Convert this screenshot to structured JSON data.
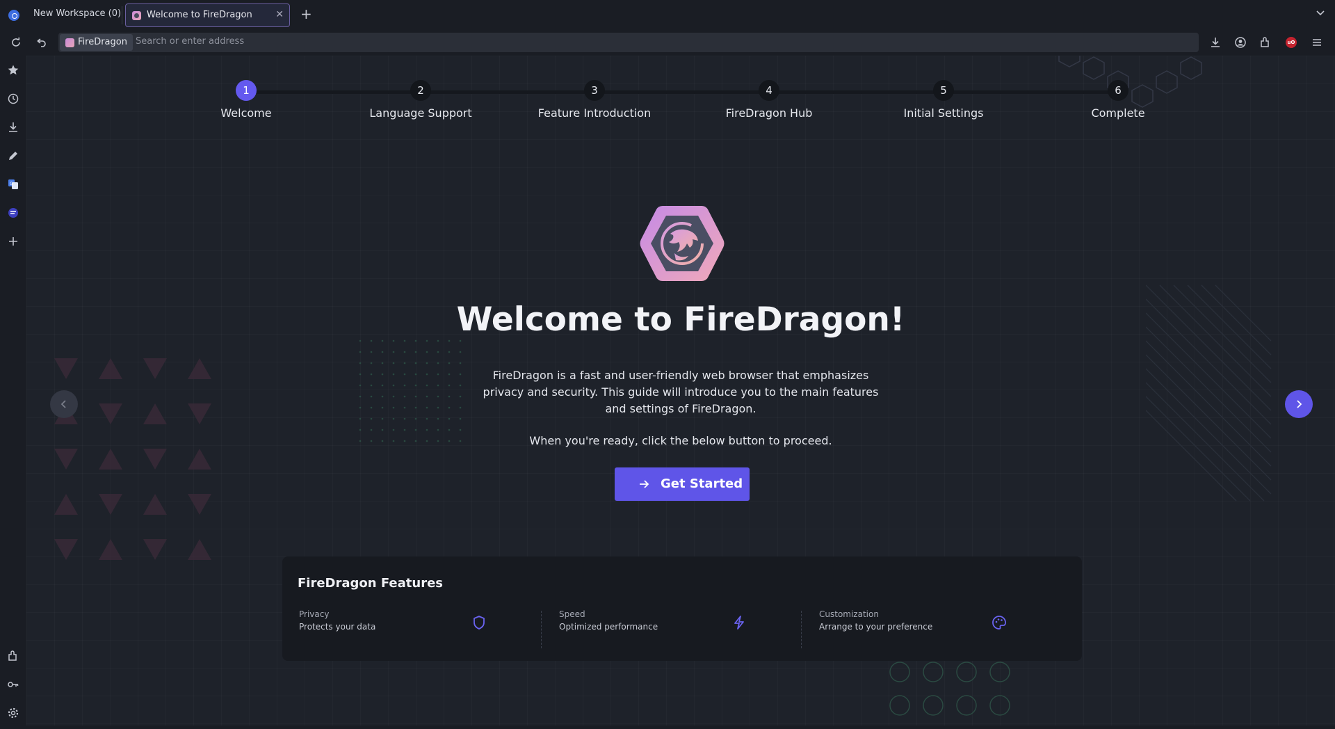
{
  "browser": {
    "workspace_label": "New Workspace (0)",
    "tabs": [
      {
        "title": "Welcome to FireDragon",
        "active": true
      }
    ],
    "identity_label": "FireDragon",
    "url_placeholder": "Search or enter address",
    "ublock_badge": "uO",
    "icons": {
      "toolbar": [
        "reload-icon",
        "undo-icon",
        "downloads-icon",
        "account-icon",
        "extensions-icon",
        "ublock-icon",
        "menu-icon"
      ],
      "sidebar": [
        "bookmarks-star-icon",
        "history-icon",
        "downloads-icon",
        "notes-pen-icon",
        "translate-icon",
        "firedragon-icon",
        "add-panel-icon",
        "extensions-icon",
        "passwords-key-icon",
        "settings-gear-icon"
      ]
    }
  },
  "stepper": {
    "active_step": 1,
    "steps": [
      {
        "num": "1",
        "label": "Welcome"
      },
      {
        "num": "2",
        "label": "Language Support"
      },
      {
        "num": "3",
        "label": "Feature Introduction"
      },
      {
        "num": "4",
        "label": "FireDragon Hub"
      },
      {
        "num": "5",
        "label": "Initial Settings"
      },
      {
        "num": "6",
        "label": "Complete"
      }
    ]
  },
  "hero": {
    "title": "Welcome to FireDragon!",
    "description": "FireDragon is a fast and user-friendly web browser that emphasizes privacy and security. This guide will introduce you to the main features and settings of FireDragon.",
    "ready_text": "When you're ready, click the below button to proceed.",
    "cta_label": "Get Started"
  },
  "features": {
    "title": "FireDragon Features",
    "items": [
      {
        "name": "Privacy",
        "desc": "Protects your data",
        "icon": "shield-icon"
      },
      {
        "name": "Speed",
        "desc": "Optimized performance",
        "icon": "lightning-icon"
      },
      {
        "name": "Customization",
        "desc": "Arrange to your preference",
        "icon": "palette-icon"
      }
    ]
  },
  "colors": {
    "accent": "#5f55e8",
    "background": "#1e222a",
    "chrome": "#1a1d24"
  }
}
